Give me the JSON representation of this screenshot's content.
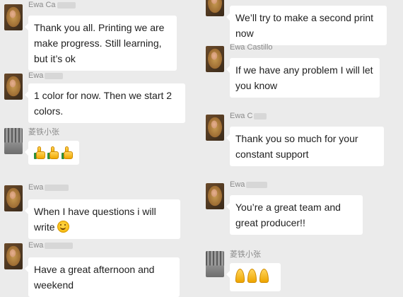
{
  "left_column": [
    {
      "sender": "Ewa Ca",
      "avatar": "ewa-avatar",
      "text": "Thank you all. Printing we are make progress. Still learning, but it’s ok"
    },
    {
      "sender": "Ewa",
      "avatar": "ewa-avatar",
      "text": "1 color for now. Then we start 2 colors."
    },
    {
      "sender": "菱铁小张",
      "avatar": "factory-avatar",
      "emoji": "thumbs-up-icon x3"
    },
    {
      "sender": "Ewa",
      "avatar": "ewa-avatar",
      "text": "When I have questions i will write",
      "trailing_emoji": "smile-icon"
    },
    {
      "sender": "Ewa",
      "avatar": "ewa-avatar",
      "text": "Have a great afternoon and weekend"
    }
  ],
  "right_column": [
    {
      "sender": "",
      "avatar": "ewa-avatar",
      "text": "We’ll try to make a second print now"
    },
    {
      "sender": "Ewa Castillo",
      "avatar": "ewa-avatar",
      "text": "If we have any problem I will let you know"
    },
    {
      "sender": "Ewa C",
      "avatar": "ewa-avatar",
      "text": "Thank you so much for your constant support"
    },
    {
      "sender": "Ewa",
      "avatar": "ewa-avatar",
      "text": "You’re a great team and great producer!!"
    },
    {
      "sender": "菱铁小张",
      "avatar": "factory-avatar",
      "emoji": "praying-hands-icon x3"
    }
  ],
  "colors": {
    "background": "#ebebeb",
    "bubble": "#ffffff",
    "sender_name": "#8a8a8a",
    "text": "#1e1e1e"
  }
}
